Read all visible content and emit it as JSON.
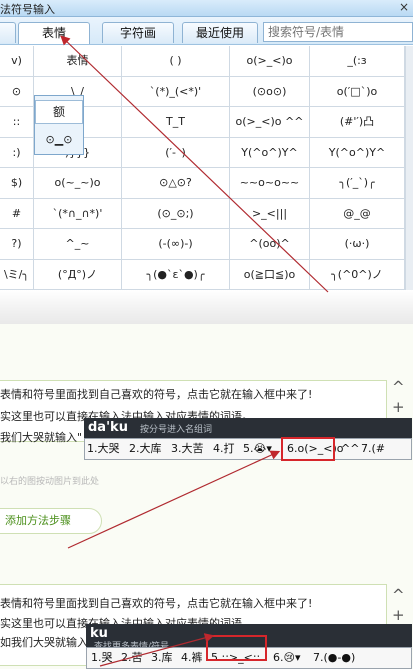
{
  "window": {
    "title": "法符号输入",
    "close": "×",
    "tabs": [
      "表情",
      "字符画",
      "最近使用"
    ],
    "search_placeholder": "搜索符号/表情"
  },
  "grid": [
    [
      "v)",
      "表情",
      "(   )",
      "o(>_<)o",
      "_(:з"
    ],
    [
      "⊙",
      "\\_/",
      "`(*)_(<*)'",
      "(⊙o⊙)",
      "o(′□`)o"
    ],
    [
      "::",
      "=",
      "T_T",
      "o(>_<)o ^^",
      "(#'′)凸"
    ],
    [
      ":)",
      ")}}}",
      "(′-`)",
      "Y(^o^)Y^",
      "Y(^o^)Y^"
    ],
    [
      "$)",
      "o(~_~)o",
      "⊙△⊙?",
      "~~o~o~~",
      "╮(′_`)╭"
    ],
    [
      "#",
      "`(*∩_∩*)'",
      "(⊙_⊙;)",
      ">_<|||",
      "@_@"
    ],
    [
      "?)",
      "^_~",
      "(-(∞)-)",
      "^(oo)^",
      "(·ω·)"
    ],
    [
      "\\ミ/╮",
      "(°Д°)ノ",
      "╮(●`ε`●)╭",
      "o(≧口≦)o",
      "╮(^0^)ノ"
    ]
  ],
  "popup": {
    "p1": "额",
    "p2": "⊙▁⊙"
  },
  "block1": {
    "line1": "表情和符号里面找到自己喜欢的符号，点击它就在输入框中来了!",
    "line2": "实这里也可以直接在输入法中输入对应表情的词语。",
    "line3": "我们大哭就输入\"",
    "ime_pinyin": "da'ku",
    "ime_hint": "按分号进入名组词",
    "cands": [
      "1.大哭",
      "2.大库",
      "3.大苦",
      "4.打",
      "5.😭▾",
      "6.o(>_<)o",
      "^^",
      "7.(#"
    ],
    "faint": "以右的图按动图片到此处",
    "add_button": "添加方法步骤"
  },
  "block2": {
    "line1": "表情和符号里面找到自己喜欢的符号，点击它就在输入框中来了!",
    "line2": "实这里也可以直接在输入法中输入对应表情的词语。",
    "line3": "如我们大哭就输入\"",
    "ime_pinyin": "ku",
    "ime_hint": "查找更多表情/符号",
    "cands": [
      "1.哭",
      "2.苦",
      "3.库",
      "4.裤",
      "5.::>_<::",
      "6.😢▾",
      "7.(●-●)"
    ]
  },
  "side": {
    "plus": "+",
    "minus": "−",
    "up": "^"
  }
}
